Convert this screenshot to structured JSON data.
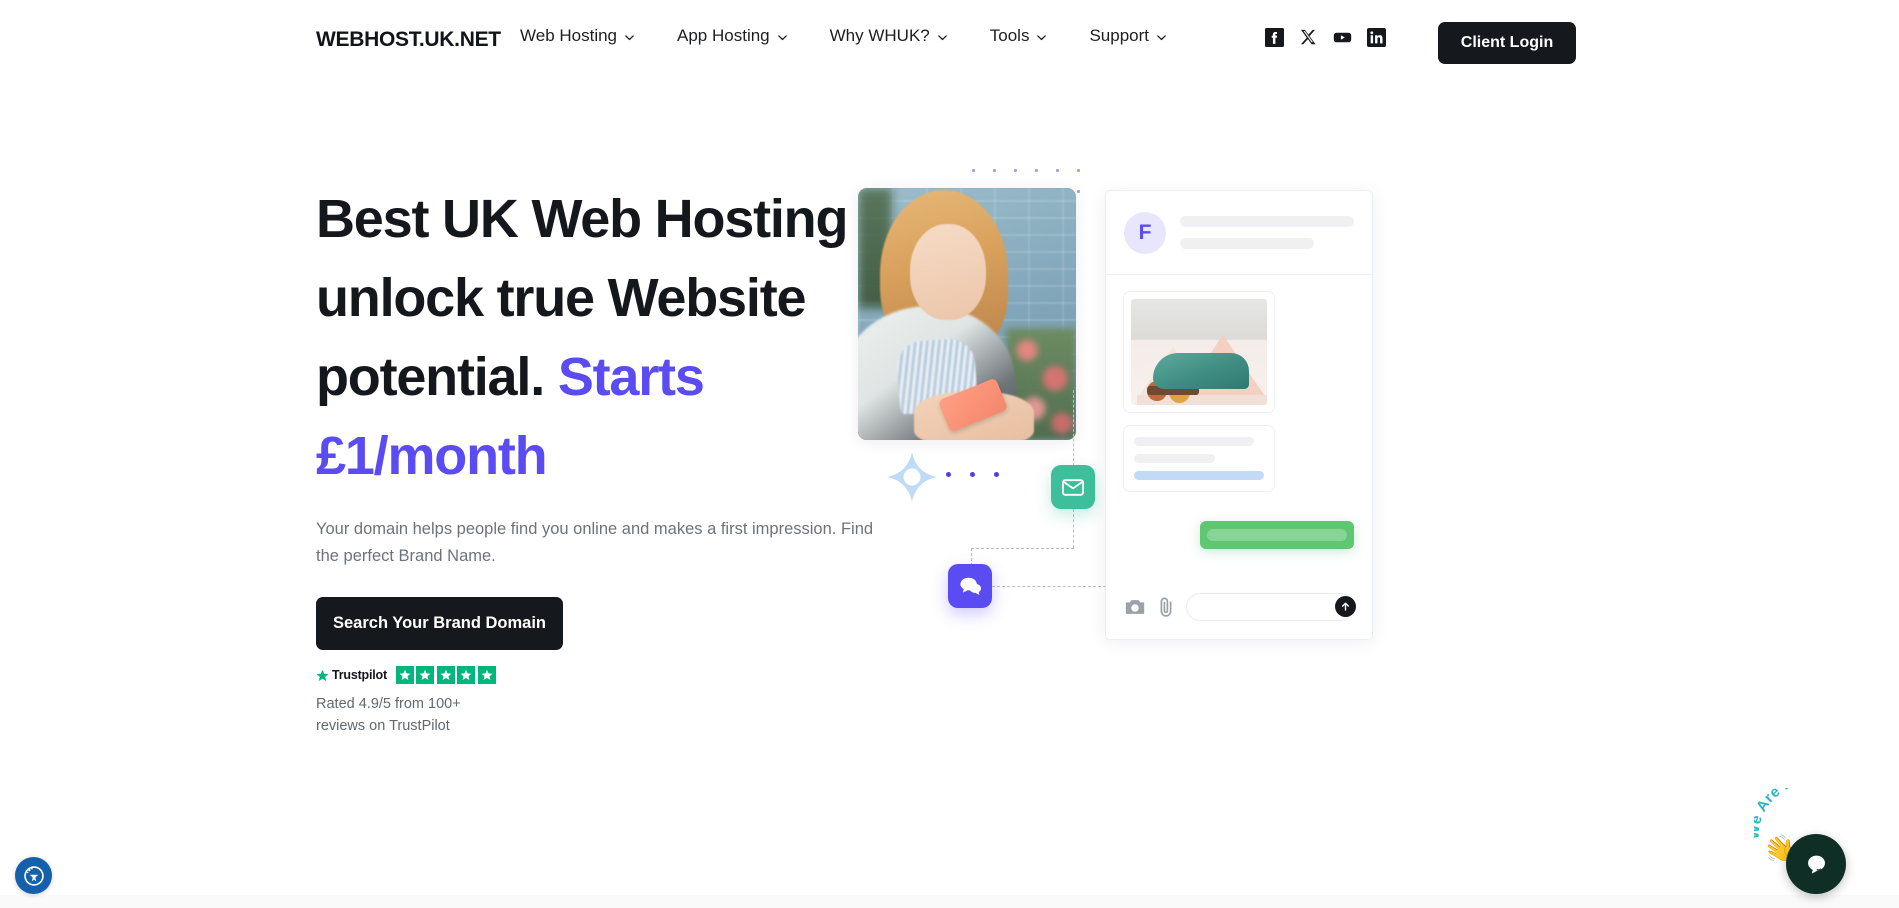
{
  "header": {
    "brand": "WEBHOST.UK.NET",
    "nav": [
      {
        "label": "Web Hosting",
        "icon": "chevron-down-icon"
      },
      {
        "label": "App Hosting",
        "icon": "chevron-down-icon"
      },
      {
        "label": "Why WHUK?",
        "icon": "chevron-down-icon"
      },
      {
        "label": "Tools",
        "icon": "chevron-down-icon"
      },
      {
        "label": "Support",
        "icon": "chevron-down-icon"
      }
    ],
    "socials": [
      {
        "name": "facebook-icon"
      },
      {
        "name": "x-twitter-icon"
      },
      {
        "name": "youtube-icon"
      },
      {
        "name": "linkedin-icon"
      }
    ],
    "login_label": "Client Login"
  },
  "hero": {
    "headline_part1": "Best UK Web Hosting to unlock true Website potential. ",
    "headline_accent": "Starts £1/month",
    "subtitle": "Your domain helps people find you online and makes a first impression. Find the perfect Brand Name.",
    "cta_label": "Search Your Brand Domain",
    "trustpilot": {
      "wordmark": "Trustpilot",
      "stars": 5,
      "rating_text": "Rated 4.9/5 from 100+ reviews on TrustPilot"
    }
  },
  "illustration": {
    "photo_alt": "woman-using-smartphone-photo",
    "post_card": {
      "avatar_letter": "F",
      "product_image_alt": "teal-suede-shoe-product-photo",
      "chat_input_placeholder": ""
    },
    "tiles": [
      {
        "name": "mail-tile",
        "icon": "envelope-icon",
        "color": "#3cbf9a"
      },
      {
        "name": "chat-tile",
        "icon": "chat-bubbles-icon",
        "color": "#5a4bf2"
      }
    ]
  },
  "widgets": {
    "accessibility": {
      "name": "accessibility-icon",
      "color": "#1560ac"
    },
    "chat": {
      "label": "We Are Here!",
      "emoji": "👋",
      "color": "#0f2e26"
    }
  },
  "colors": {
    "accent_purple": "#5a4bf2",
    "dark": "#15181c",
    "trustpilot_green": "#00b67a",
    "mail_green": "#3cbf9a",
    "bubble_green": "#5fc671",
    "body_text": "#6c737c"
  }
}
